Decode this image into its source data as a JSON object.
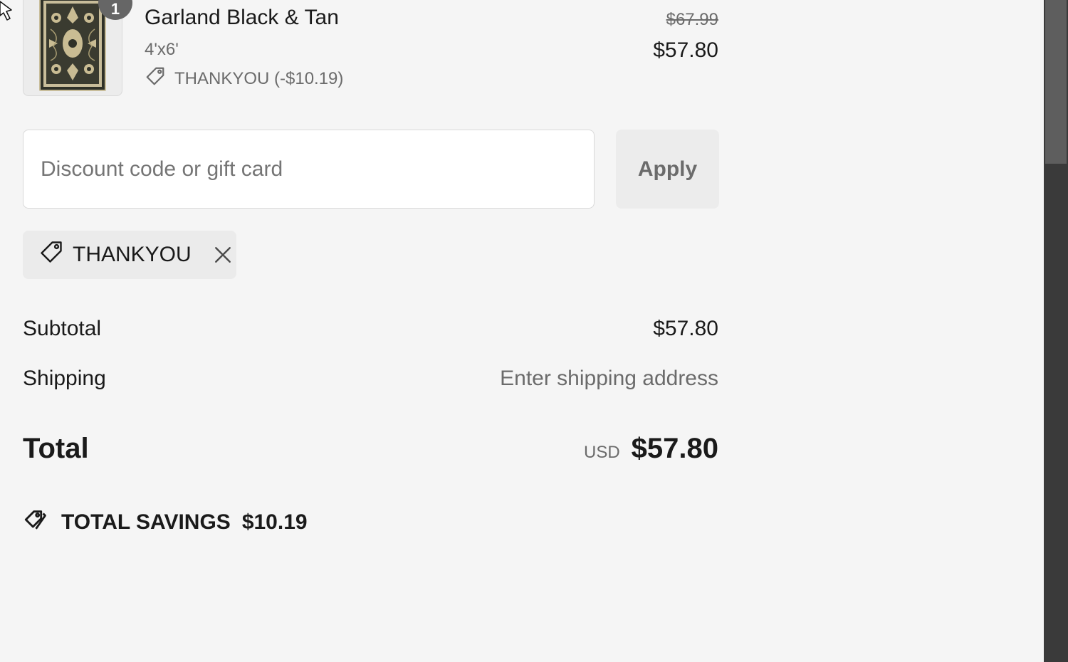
{
  "product": {
    "name": "Garland Black & Tan",
    "variant": "4'x6'",
    "discount_line": "THANKYOU (-$10.19)",
    "original_price": "$67.99",
    "price": "$57.80",
    "quantity": "1",
    "thumbnail_colors": {
      "background": "#c8bd9a",
      "pattern": "#2f3128"
    }
  },
  "discount": {
    "placeholder": "Discount code or gift card",
    "value": "",
    "apply_label": "Apply"
  },
  "applied_code": {
    "code": "THANKYOU"
  },
  "summary": {
    "subtotal_label": "Subtotal",
    "subtotal_value": "$57.80",
    "shipping_label": "Shipping",
    "shipping_value": "Enter shipping address",
    "total_label": "Total",
    "currency": "USD",
    "total_value": "$57.80"
  },
  "savings": {
    "label": "TOTAL SAVINGS",
    "amount": "$10.19"
  },
  "icons": {
    "tag": "tag-icon",
    "close": "close-icon",
    "tags": "tags-icon",
    "cursor": "mouse-pointer-icon"
  },
  "colors": {
    "page_background": "#f5f5f5",
    "text": "#1a1a1a",
    "muted_text": "#6b6b6b",
    "scrollbar_track": "#3a3a3a",
    "scrollbar_thumb": "#5e5e5e"
  }
}
